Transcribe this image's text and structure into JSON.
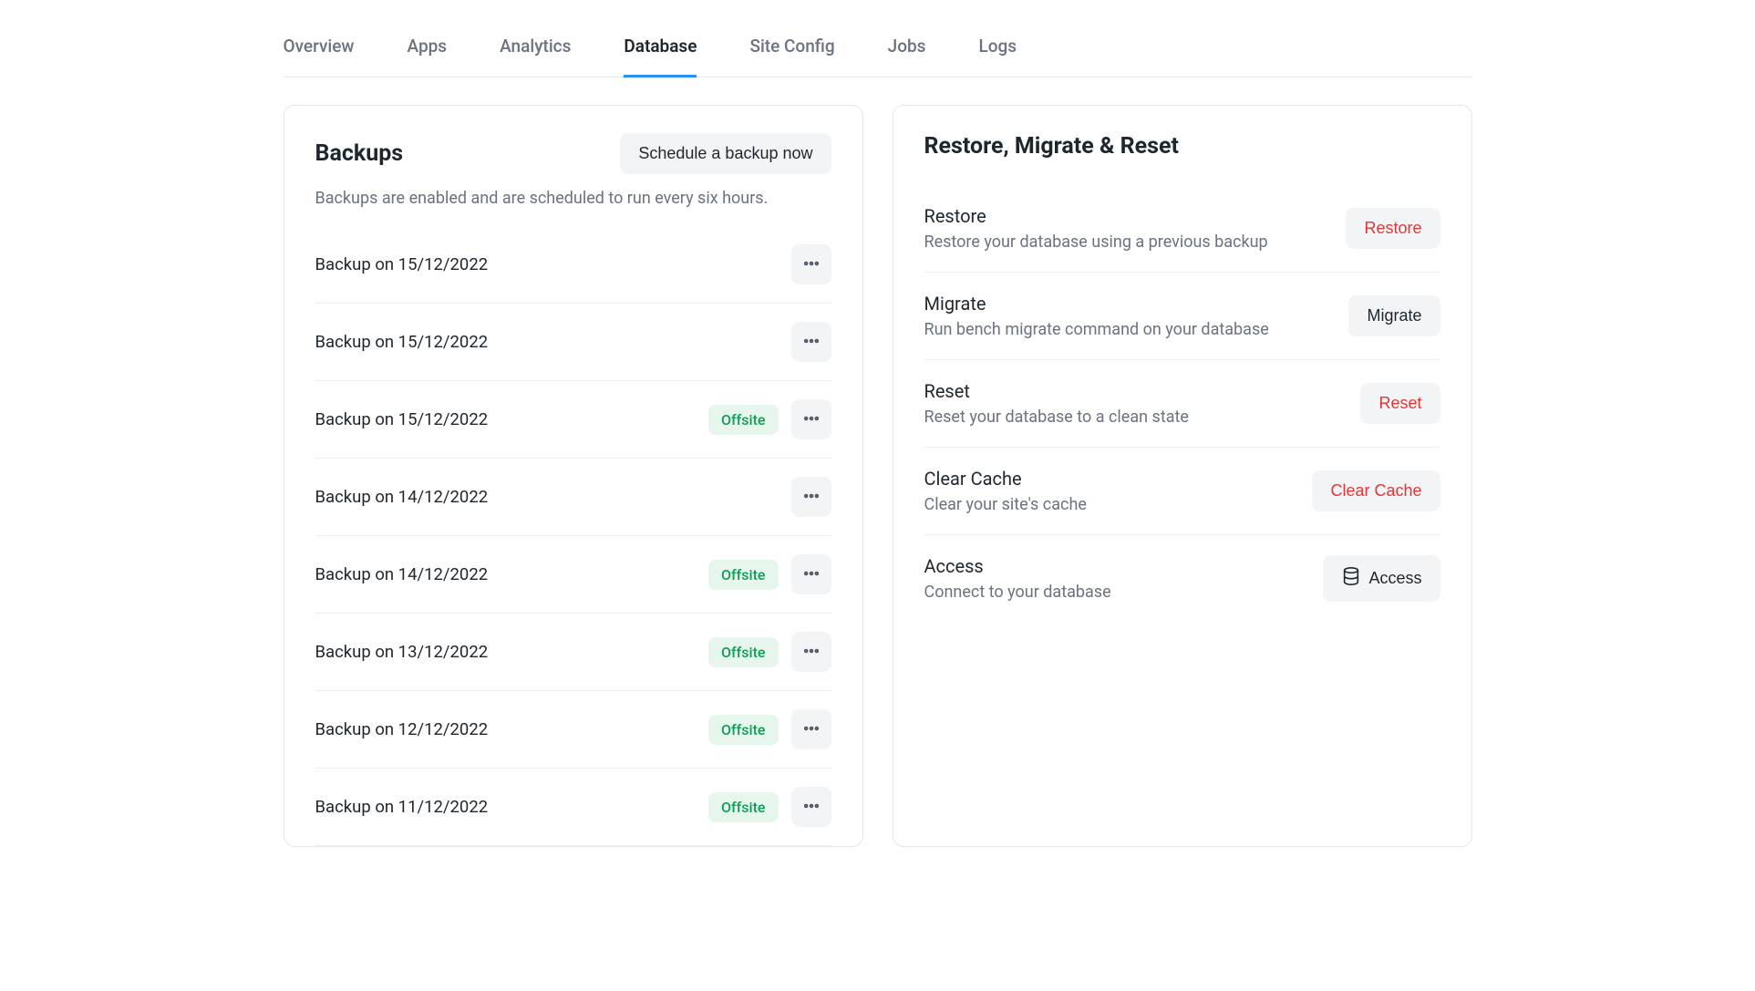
{
  "tabs": [
    {
      "label": "Overview",
      "active": false
    },
    {
      "label": "Apps",
      "active": false
    },
    {
      "label": "Analytics",
      "active": false
    },
    {
      "label": "Database",
      "active": true
    },
    {
      "label": "Site Config",
      "active": false
    },
    {
      "label": "Jobs",
      "active": false
    },
    {
      "label": "Logs",
      "active": false
    }
  ],
  "backups": {
    "title": "Backups",
    "schedule_button": "Schedule a backup now",
    "subtitle": "Backups are enabled and are scheduled to run every six hours.",
    "offsite_label": "Offsite",
    "items": [
      {
        "label": "Backup on 15/12/2022",
        "offsite": false
      },
      {
        "label": "Backup on 15/12/2022",
        "offsite": false
      },
      {
        "label": "Backup on 15/12/2022",
        "offsite": true
      },
      {
        "label": "Backup on 14/12/2022",
        "offsite": false
      },
      {
        "label": "Backup on 14/12/2022",
        "offsite": true
      },
      {
        "label": "Backup on 13/12/2022",
        "offsite": true
      },
      {
        "label": "Backup on 12/12/2022",
        "offsite": true
      },
      {
        "label": "Backup on 11/12/2022",
        "offsite": true
      }
    ]
  },
  "restore_panel": {
    "title": "Restore, Migrate & Reset",
    "actions": [
      {
        "title": "Restore",
        "desc": "Restore your database using a previous backup",
        "button": "Restore",
        "danger": true,
        "icon": null
      },
      {
        "title": "Migrate",
        "desc": "Run bench migrate command on your database",
        "button": "Migrate",
        "danger": false,
        "icon": null
      },
      {
        "title": "Reset",
        "desc": "Reset your database to a clean state",
        "button": "Reset",
        "danger": true,
        "icon": null
      },
      {
        "title": "Clear Cache",
        "desc": "Clear your site's cache",
        "button": "Clear Cache",
        "danger": true,
        "icon": null
      },
      {
        "title": "Access",
        "desc": "Connect to your database",
        "button": "Access",
        "danger": false,
        "icon": "database"
      }
    ]
  }
}
